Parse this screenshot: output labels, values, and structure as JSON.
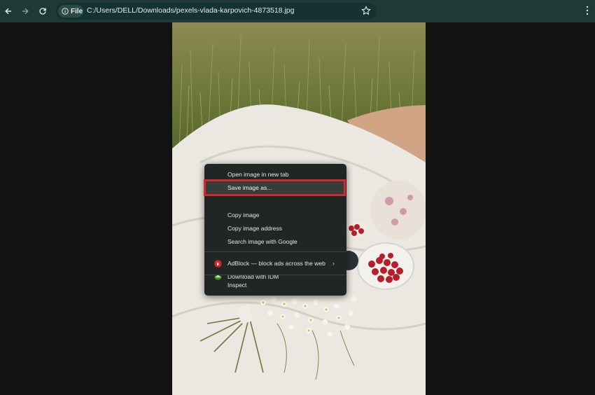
{
  "toolbar": {
    "back_icon": "arrow-left-icon",
    "forward_icon": "arrow-right-icon",
    "reload_icon": "reload-icon",
    "chip_label": "File",
    "url": "C:/Users/DELL/Downloads/pexels-vlada-karpovich-4873518.jpg",
    "bookmark_icon": "star-icon",
    "menu_icon": "kebab-menu-icon"
  },
  "context_menu": {
    "items": [
      {
        "label": "Open image in new tab"
      },
      {
        "label": "Save image as..."
      },
      {
        "label": "Copy image"
      },
      {
        "label": "Copy image address"
      },
      {
        "label": "Search image with Google"
      },
      {
        "label": "AdBlock — block ads across the web",
        "icon": "adblock-icon",
        "submenu": "›"
      },
      {
        "label": "Download with IDM",
        "icon": "idm-icon"
      },
      {
        "label": "Inspect"
      }
    ],
    "highlight_color": "#d7262b"
  },
  "colors": {
    "toolbar": "#1f3a36",
    "page_background": "#121212",
    "menu_background": "#1f2624"
  }
}
